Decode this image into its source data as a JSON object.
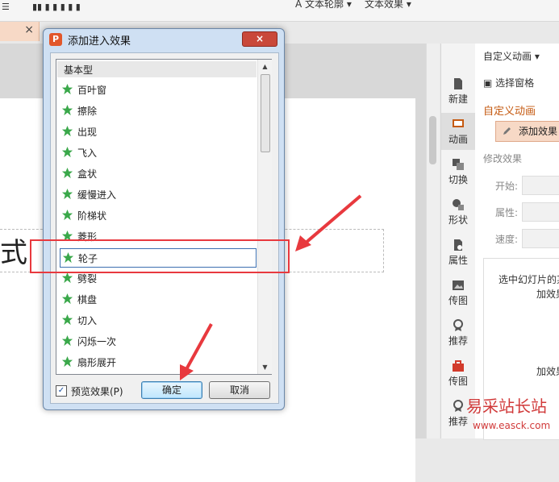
{
  "ribbon": {
    "text_outline": "文本轮廓",
    "text_effect": "文本效果"
  },
  "document_tab": {
    "close_glyph": "×"
  },
  "slide": {
    "visible_title_fragment": "式"
  },
  "sidebar": {
    "items": [
      {
        "label": "新建",
        "icon": "new-slide-icon"
      },
      {
        "label": "动画",
        "icon": "animation-icon"
      },
      {
        "label": "切换",
        "icon": "transition-icon"
      },
      {
        "label": "形状",
        "icon": "shapes-icon"
      },
      {
        "label": "属性",
        "icon": "properties-icon"
      },
      {
        "label": "传图",
        "icon": "upload-image-icon"
      },
      {
        "label": "推荐",
        "icon": "recommend-icon"
      },
      {
        "label": "传图",
        "icon": "toolbox-icon"
      },
      {
        "label": "推荐",
        "icon": "recommend-icon"
      }
    ]
  },
  "task_pane": {
    "dropdown": "自定义动画",
    "select_pane": "选择窗格",
    "section_title": "自定义动画",
    "add_effect": "添加效果",
    "modify_effect": "修改效果",
    "start_label": "开始:",
    "property_label": "属性:",
    "speed_label": "速度:",
    "info_line1": "选中幻灯片的某",
    "info_line2": "加效果",
    "info_line3": "加效果"
  },
  "dialog": {
    "title": "添加进入效果",
    "close_glyph": "×",
    "list_header": "基本型",
    "items": [
      "百叶窗",
      "擦除",
      "出现",
      "飞入",
      "盒状",
      "缓慢进入",
      "阶梯状",
      "菱形",
      "轮子",
      "劈裂",
      "棋盘",
      "切入",
      "闪烁一次",
      "扇形展开"
    ],
    "selected_item": "轮子",
    "preview_checkbox": "预览效果(P)",
    "preview_checked": true,
    "ok_button": "确定",
    "cancel_button": "取消"
  },
  "watermark": {
    "line1": "易采站长站",
    "line2": "www.easck.com"
  },
  "colors": {
    "accent": "#c55a11",
    "annotation_red": "#e8393e",
    "star_green": "#3aa84a"
  }
}
